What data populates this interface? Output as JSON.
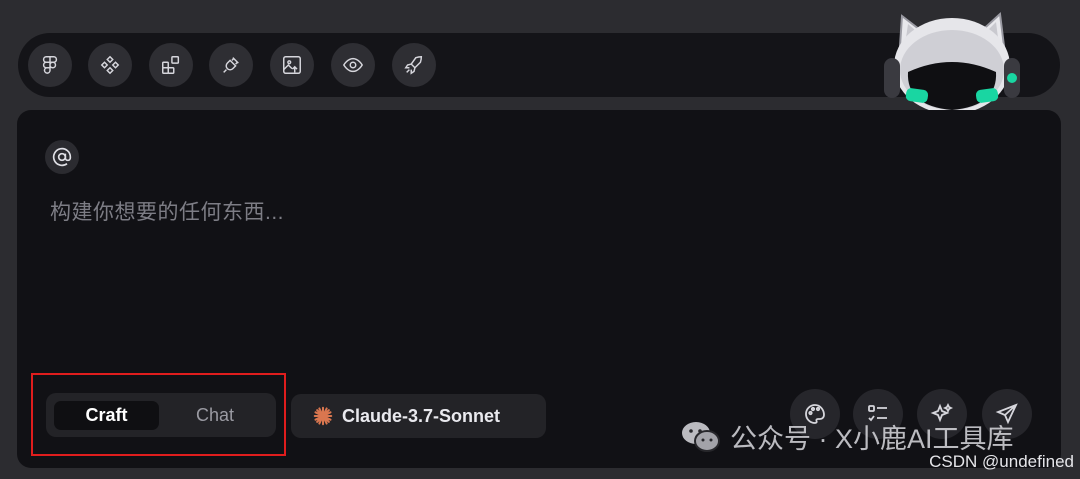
{
  "toolbar": {
    "icons": [
      "figma-icon",
      "components-icon",
      "blocks-icon",
      "plug-icon",
      "image-upload-icon",
      "eye-icon",
      "rocket-icon"
    ]
  },
  "mascot": {
    "icon": "robot-cat-mascot"
  },
  "composer": {
    "mention_icon": "at-icon",
    "placeholder": "构建你想要的任何东西..."
  },
  "mode": {
    "options": [
      "Craft",
      "Chat"
    ],
    "selected": "Craft"
  },
  "model": {
    "icon": "claude-sparkle-icon",
    "label": "Claude-3.7-Sonnet",
    "accent": "#d9764f"
  },
  "actions": {
    "icons": [
      "palette-icon",
      "checklist-icon",
      "sparkles-icon",
      "send-icon"
    ]
  },
  "watermark": {
    "text": "公众号 · X小鹿AI工具库",
    "credit": "CSDN @undefined"
  },
  "colors": {
    "background": "#2c2c30",
    "panel": "#111115",
    "highlight": "#e01d1d",
    "mascot_eyes": "#19d6a2"
  }
}
